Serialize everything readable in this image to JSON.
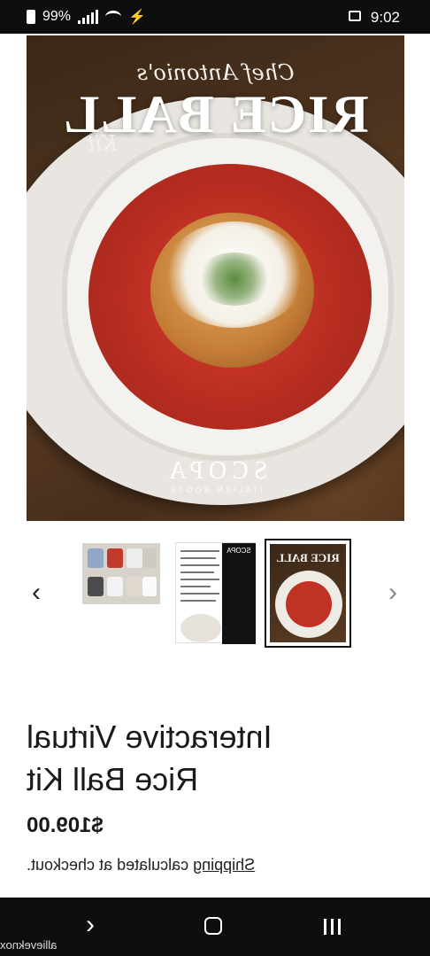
{
  "status_bar": {
    "time": "9:02",
    "battery": "99%",
    "icons": [
      "image-icon",
      "signal-icon",
      "wifi-icon",
      "bolt-icon",
      "battery-icon"
    ]
  },
  "hero": {
    "script_text": "Chef Antonio's",
    "title": "RICE BALL",
    "kit_text": "Kit",
    "brand": "SCOPA",
    "brand_sub": "ITALIAN ROOTS"
  },
  "gallery": {
    "thumb2_title": "SCOPA",
    "thumb3_title": "RICE BALL"
  },
  "product": {
    "name_line1": "Interactive Virtual",
    "name_line2": "Rice Ball Kit",
    "price": "$109.00",
    "shipping_link": "Shipping",
    "shipping_rest": " calculated at checkout."
  },
  "navbar": {
    "watermark": "allieveknox"
  },
  "colors": {
    "bar_bg": "#0e0e0e",
    "sauce": "#b52c20",
    "text": "#1a1a1a"
  }
}
